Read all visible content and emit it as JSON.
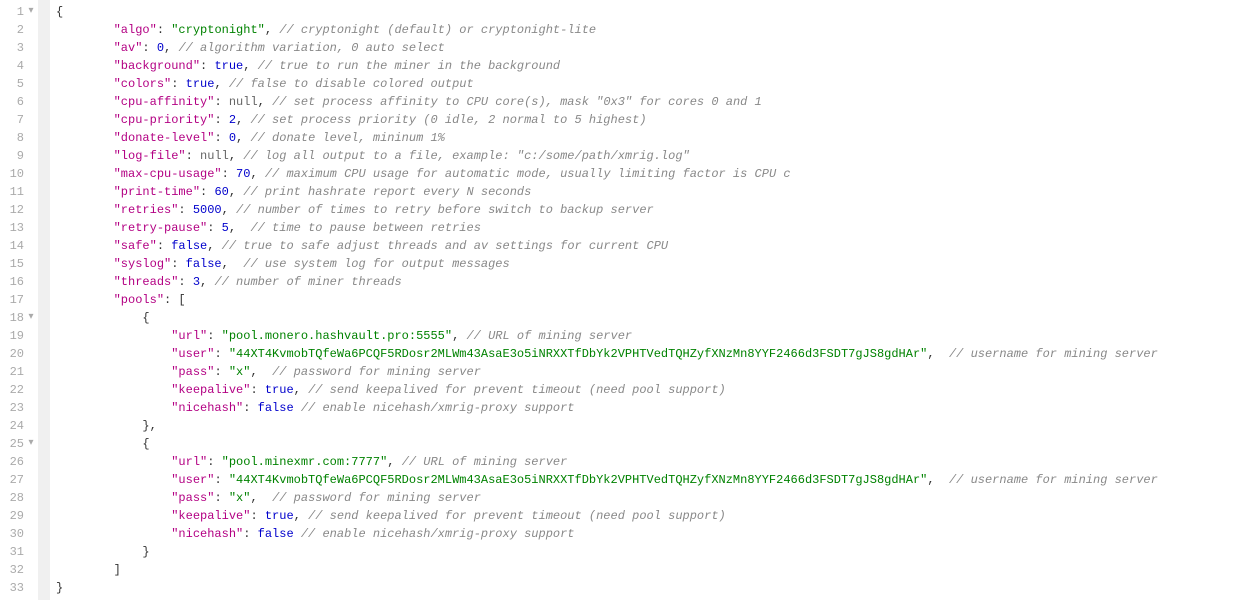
{
  "lines": [
    {
      "num": 1,
      "fold": "▾",
      "indent": 0,
      "segs": [
        {
          "t": "{",
          "c": "p"
        }
      ]
    },
    {
      "num": 2,
      "indent": 2,
      "segs": [
        {
          "t": "\"algo\"",
          "c": "k"
        },
        {
          "t": ": ",
          "c": "p"
        },
        {
          "t": "\"cryptonight\"",
          "c": "s"
        },
        {
          "t": ", ",
          "c": "p"
        },
        {
          "t": "// cryptonight (default) or cryptonight-lite",
          "c": "c"
        }
      ]
    },
    {
      "num": 3,
      "indent": 2,
      "segs": [
        {
          "t": "\"av\"",
          "c": "k"
        },
        {
          "t": ": ",
          "c": "p"
        },
        {
          "t": "0",
          "c": "n"
        },
        {
          "t": ", ",
          "c": "p"
        },
        {
          "t": "// algorithm variation, 0 auto select",
          "c": "c"
        }
      ]
    },
    {
      "num": 4,
      "indent": 2,
      "segs": [
        {
          "t": "\"background\"",
          "c": "k"
        },
        {
          "t": ": ",
          "c": "p"
        },
        {
          "t": "true",
          "c": "b"
        },
        {
          "t": ", ",
          "c": "p"
        },
        {
          "t": "// true to run the miner in the background",
          "c": "c"
        }
      ]
    },
    {
      "num": 5,
      "indent": 2,
      "segs": [
        {
          "t": "\"colors\"",
          "c": "k"
        },
        {
          "t": ": ",
          "c": "p"
        },
        {
          "t": "true",
          "c": "b"
        },
        {
          "t": ", ",
          "c": "p"
        },
        {
          "t": "// false to disable colored output",
          "c": "c"
        }
      ]
    },
    {
      "num": 6,
      "indent": 2,
      "segs": [
        {
          "t": "\"cpu-affinity\"",
          "c": "k"
        },
        {
          "t": ": ",
          "c": "p"
        },
        {
          "t": "null",
          "c": "nl"
        },
        {
          "t": ", ",
          "c": "p"
        },
        {
          "t": "// set process affinity to CPU core(s), mask \"0x3\" for cores 0 and 1",
          "c": "c"
        }
      ]
    },
    {
      "num": 7,
      "indent": 2,
      "segs": [
        {
          "t": "\"cpu-priority\"",
          "c": "k"
        },
        {
          "t": ": ",
          "c": "p"
        },
        {
          "t": "2",
          "c": "n"
        },
        {
          "t": ", ",
          "c": "p"
        },
        {
          "t": "// set process priority (0 idle, 2 normal to 5 highest)",
          "c": "c"
        }
      ]
    },
    {
      "num": 8,
      "indent": 2,
      "segs": [
        {
          "t": "\"donate-level\"",
          "c": "k"
        },
        {
          "t": ": ",
          "c": "p"
        },
        {
          "t": "0",
          "c": "n"
        },
        {
          "t": ", ",
          "c": "p"
        },
        {
          "t": "// donate level, mininum 1%",
          "c": "c"
        }
      ]
    },
    {
      "num": 9,
      "indent": 2,
      "segs": [
        {
          "t": "\"log-file\"",
          "c": "k"
        },
        {
          "t": ": ",
          "c": "p"
        },
        {
          "t": "null",
          "c": "nl"
        },
        {
          "t": ", ",
          "c": "p"
        },
        {
          "t": "// log all output to a file, example: \"c:/some/path/xmrig.log\"",
          "c": "c"
        }
      ]
    },
    {
      "num": 10,
      "indent": 2,
      "segs": [
        {
          "t": "\"max-cpu-usage\"",
          "c": "k"
        },
        {
          "t": ": ",
          "c": "p"
        },
        {
          "t": "70",
          "c": "n"
        },
        {
          "t": ", ",
          "c": "p"
        },
        {
          "t": "// maximum CPU usage for automatic mode, usually limiting factor is CPU c",
          "c": "c"
        }
      ]
    },
    {
      "num": 11,
      "indent": 2,
      "segs": [
        {
          "t": "\"print-time\"",
          "c": "k"
        },
        {
          "t": ": ",
          "c": "p"
        },
        {
          "t": "60",
          "c": "n"
        },
        {
          "t": ", ",
          "c": "p"
        },
        {
          "t": "// print hashrate report every N seconds",
          "c": "c"
        }
      ]
    },
    {
      "num": 12,
      "indent": 2,
      "segs": [
        {
          "t": "\"retries\"",
          "c": "k"
        },
        {
          "t": ": ",
          "c": "p"
        },
        {
          "t": "5000",
          "c": "n"
        },
        {
          "t": ", ",
          "c": "p"
        },
        {
          "t": "// number of times to retry before switch to backup server",
          "c": "c"
        }
      ]
    },
    {
      "num": 13,
      "indent": 2,
      "segs": [
        {
          "t": "\"retry-pause\"",
          "c": "k"
        },
        {
          "t": ": ",
          "c": "p"
        },
        {
          "t": "5",
          "c": "n"
        },
        {
          "t": ",  ",
          "c": "p"
        },
        {
          "t": "// time to pause between retries",
          "c": "c"
        }
      ]
    },
    {
      "num": 14,
      "indent": 2,
      "segs": [
        {
          "t": "\"safe\"",
          "c": "k"
        },
        {
          "t": ": ",
          "c": "p"
        },
        {
          "t": "false",
          "c": "b"
        },
        {
          "t": ", ",
          "c": "p"
        },
        {
          "t": "// true to safe adjust threads and av settings for current CPU",
          "c": "c"
        }
      ]
    },
    {
      "num": 15,
      "indent": 2,
      "segs": [
        {
          "t": "\"syslog\"",
          "c": "k"
        },
        {
          "t": ": ",
          "c": "p"
        },
        {
          "t": "false",
          "c": "b"
        },
        {
          "t": ",  ",
          "c": "p"
        },
        {
          "t": "// use system log for output messages",
          "c": "c"
        }
      ]
    },
    {
      "num": 16,
      "indent": 2,
      "segs": [
        {
          "t": "\"threads\"",
          "c": "k"
        },
        {
          "t": ": ",
          "c": "p"
        },
        {
          "t": "3",
          "c": "n"
        },
        {
          "t": ", ",
          "c": "p"
        },
        {
          "t": "// number of miner threads",
          "c": "c"
        }
      ]
    },
    {
      "num": 17,
      "indent": 2,
      "segs": [
        {
          "t": "\"pools\"",
          "c": "k"
        },
        {
          "t": ": [",
          "c": "p"
        }
      ]
    },
    {
      "num": 18,
      "fold": "▾",
      "indent": 3,
      "segs": [
        {
          "t": "{",
          "c": "p"
        }
      ]
    },
    {
      "num": 19,
      "indent": 4,
      "segs": [
        {
          "t": "\"url\"",
          "c": "k"
        },
        {
          "t": ": ",
          "c": "p"
        },
        {
          "t": "\"pool.monero.hashvault.pro:5555\"",
          "c": "s"
        },
        {
          "t": ", ",
          "c": "p"
        },
        {
          "t": "// URL of mining server",
          "c": "c"
        }
      ]
    },
    {
      "num": 20,
      "indent": 4,
      "segs": [
        {
          "t": "\"user\"",
          "c": "k"
        },
        {
          "t": ": ",
          "c": "p"
        },
        {
          "t": "\"44XT4KvmobTQfeWa6PCQF5RDosr2MLWm43AsaE3o5iNRXXTfDbYk2VPHTVedTQHZyfXNzMn8YYF2466d3FSDT7gJS8gdHAr\"",
          "c": "s"
        },
        {
          "t": ",  ",
          "c": "p"
        },
        {
          "t": "// username for mining server",
          "c": "c"
        }
      ]
    },
    {
      "num": 21,
      "indent": 4,
      "segs": [
        {
          "t": "\"pass\"",
          "c": "k"
        },
        {
          "t": ": ",
          "c": "p"
        },
        {
          "t": "\"x\"",
          "c": "s"
        },
        {
          "t": ",  ",
          "c": "p"
        },
        {
          "t": "// password for mining server",
          "c": "c"
        }
      ]
    },
    {
      "num": 22,
      "indent": 4,
      "segs": [
        {
          "t": "\"keepalive\"",
          "c": "k"
        },
        {
          "t": ": ",
          "c": "p"
        },
        {
          "t": "true",
          "c": "b"
        },
        {
          "t": ", ",
          "c": "p"
        },
        {
          "t": "// send keepalived for prevent timeout (need pool support)",
          "c": "c"
        }
      ]
    },
    {
      "num": 23,
      "indent": 4,
      "segs": [
        {
          "t": "\"nicehash\"",
          "c": "k"
        },
        {
          "t": ": ",
          "c": "p"
        },
        {
          "t": "false",
          "c": "b"
        },
        {
          "t": " ",
          "c": "p"
        },
        {
          "t": "// enable nicehash/xmrig-proxy support",
          "c": "c"
        }
      ]
    },
    {
      "num": 24,
      "indent": 3,
      "segs": [
        {
          "t": "},",
          "c": "p"
        }
      ]
    },
    {
      "num": 25,
      "fold": "▾",
      "indent": 3,
      "segs": [
        {
          "t": "{",
          "c": "p"
        }
      ]
    },
    {
      "num": 26,
      "indent": 4,
      "segs": [
        {
          "t": "\"url\"",
          "c": "k"
        },
        {
          "t": ": ",
          "c": "p"
        },
        {
          "t": "\"pool.minexmr.com:7777\"",
          "c": "s"
        },
        {
          "t": ", ",
          "c": "p"
        },
        {
          "t": "// URL of mining server",
          "c": "c"
        }
      ]
    },
    {
      "num": 27,
      "indent": 4,
      "segs": [
        {
          "t": "\"user\"",
          "c": "k"
        },
        {
          "t": ": ",
          "c": "p"
        },
        {
          "t": "\"44XT4KvmobTQfeWa6PCQF5RDosr2MLWm43AsaE3o5iNRXXTfDbYk2VPHTVedTQHZyfXNzMn8YYF2466d3FSDT7gJS8gdHAr\"",
          "c": "s"
        },
        {
          "t": ",  ",
          "c": "p"
        },
        {
          "t": "// username for mining server",
          "c": "c"
        }
      ]
    },
    {
      "num": 28,
      "indent": 4,
      "segs": [
        {
          "t": "\"pass\"",
          "c": "k"
        },
        {
          "t": ": ",
          "c": "p"
        },
        {
          "t": "\"x\"",
          "c": "s"
        },
        {
          "t": ",  ",
          "c": "p"
        },
        {
          "t": "// password for mining server",
          "c": "c"
        }
      ]
    },
    {
      "num": 29,
      "indent": 4,
      "segs": [
        {
          "t": "\"keepalive\"",
          "c": "k"
        },
        {
          "t": ": ",
          "c": "p"
        },
        {
          "t": "true",
          "c": "b"
        },
        {
          "t": ", ",
          "c": "p"
        },
        {
          "t": "// send keepalived for prevent timeout (need pool support)",
          "c": "c"
        }
      ]
    },
    {
      "num": 30,
      "indent": 4,
      "segs": [
        {
          "t": "\"nicehash\"",
          "c": "k"
        },
        {
          "t": ": ",
          "c": "p"
        },
        {
          "t": "false",
          "c": "b"
        },
        {
          "t": " ",
          "c": "p"
        },
        {
          "t": "// enable nicehash/xmrig-proxy support",
          "c": "c"
        }
      ]
    },
    {
      "num": 31,
      "indent": 3,
      "segs": [
        {
          "t": "}",
          "c": "p"
        }
      ]
    },
    {
      "num": 32,
      "indent": 2,
      "segs": [
        {
          "t": "]",
          "c": "p"
        }
      ]
    },
    {
      "num": 33,
      "indent": 0,
      "segs": [
        {
          "t": "}",
          "c": "p"
        }
      ]
    }
  ],
  "indent_unit": "    ",
  "indent_base": "    "
}
